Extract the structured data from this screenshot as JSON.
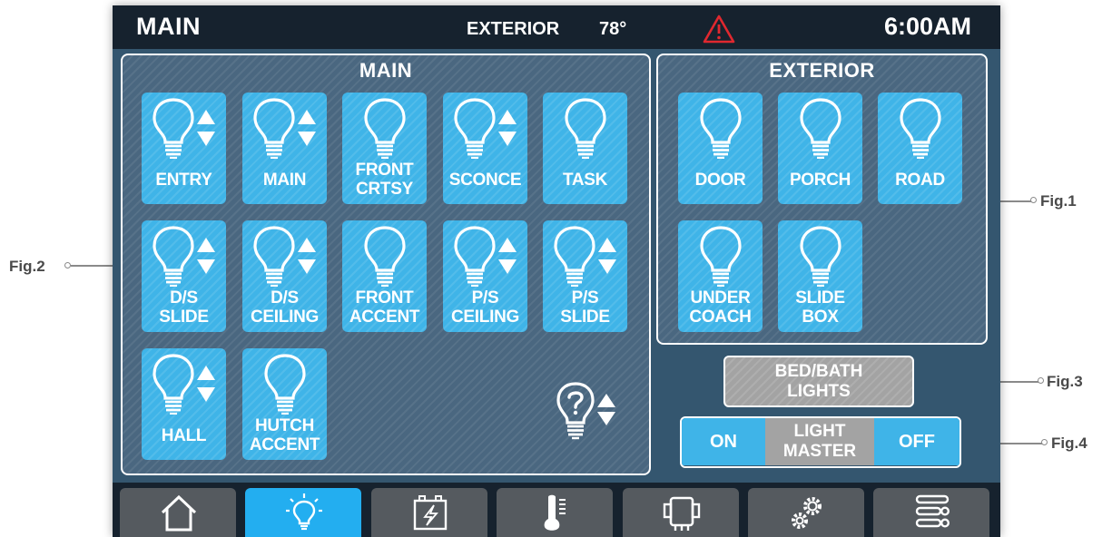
{
  "topbar": {
    "title": "MAIN",
    "exterior_label": "EXTERIOR",
    "temperature": "78°",
    "time": "6:00AM",
    "warning_icon": "warning-triangle-icon",
    "warning_color": "#e0282f"
  },
  "main_panel": {
    "title": "MAIN",
    "tiles": [
      {
        "label": "ENTRY",
        "dimmable": true
      },
      {
        "label": "MAIN",
        "dimmable": true
      },
      {
        "label": "FRONT\nCRTSY",
        "dimmable": false
      },
      {
        "label": "SCONCE",
        "dimmable": true
      },
      {
        "label": "TASK",
        "dimmable": false
      },
      {
        "label": "D/S\nSLIDE",
        "dimmable": true
      },
      {
        "label": "D/S\nCEILING",
        "dimmable": true
      },
      {
        "label": "FRONT\nACCENT",
        "dimmable": false
      },
      {
        "label": "P/S\nCEILING",
        "dimmable": true
      },
      {
        "label": "P/S\nSLIDE",
        "dimmable": true
      },
      {
        "label": "HALL",
        "dimmable": true
      },
      {
        "label": "HUTCH\nACCENT",
        "dimmable": false
      }
    ],
    "unknown_icon": "question-bulb-icon"
  },
  "exterior_panel": {
    "title": "EXTERIOR",
    "tiles": [
      {
        "label": "DOOR",
        "dimmable": false
      },
      {
        "label": "PORCH",
        "dimmable": false
      },
      {
        "label": "ROAD",
        "dimmable": false
      },
      {
        "label": "UNDER\nCOACH",
        "dimmable": false
      },
      {
        "label": "SLIDE\nBOX",
        "dimmable": false
      }
    ]
  },
  "bedbath": {
    "label": "BED/BATH\nLIGHTS"
  },
  "master": {
    "on": "ON",
    "label": "LIGHT\nMASTER",
    "off": "OFF"
  },
  "nav": [
    {
      "icon": "home-icon",
      "active": false
    },
    {
      "icon": "light-bulb-icon",
      "active": true
    },
    {
      "icon": "battery-icon",
      "active": false
    },
    {
      "icon": "thermometer-icon",
      "active": false
    },
    {
      "icon": "generator-icon",
      "active": false
    },
    {
      "icon": "gears-icon",
      "active": false
    },
    {
      "icon": "sliders-icon",
      "active": false
    }
  ],
  "callouts": {
    "fig1": "Fig.1",
    "fig2": "Fig.2",
    "fig3": "Fig.3",
    "fig4": "Fig.4"
  },
  "colors": {
    "tile_blue": "#3fb4e8",
    "nav_active": "#23aef0",
    "screen_bg": "#34566f",
    "topbar_bg": "#16222e",
    "disabled_gray": "#a3a3a3"
  }
}
